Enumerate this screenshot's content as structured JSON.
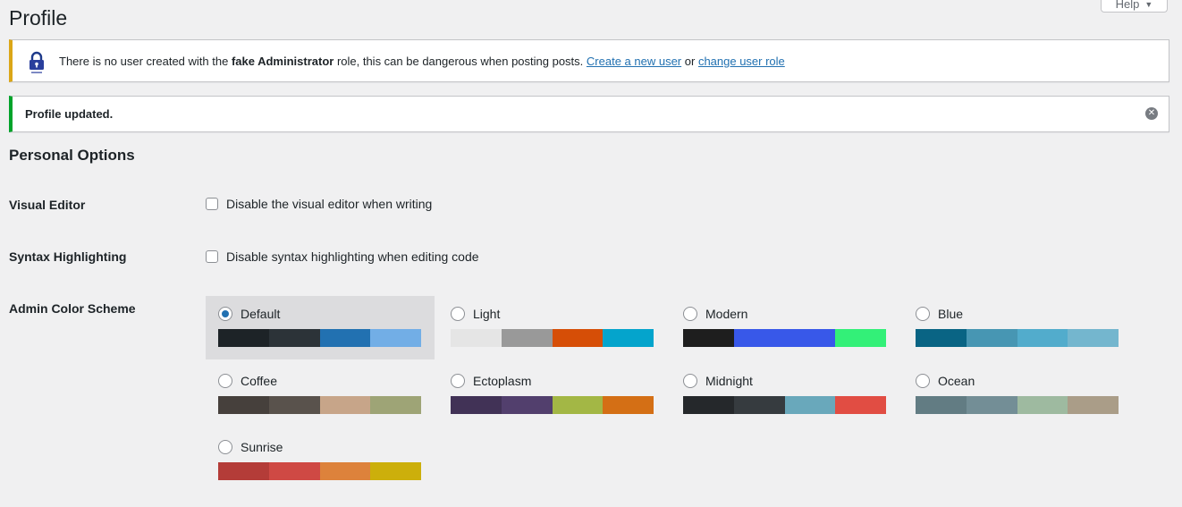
{
  "page": {
    "title": "Profile",
    "help_label": "Help"
  },
  "warning_notice": {
    "text_before": "There is no user created with the ",
    "role": "fake Administrator",
    "text_after": " role, this can be dangerous when posting posts. ",
    "link_create": "Create a new user",
    "connector": " or ",
    "link_change": "change user role"
  },
  "success_notice": {
    "text": "Profile updated."
  },
  "personal_options": {
    "title": "Personal Options",
    "visual_editor": {
      "label": "Visual Editor",
      "option": "Disable the visual editor when writing"
    },
    "syntax_highlighting": {
      "label": "Syntax Highlighting",
      "option": "Disable syntax highlighting when editing code"
    },
    "admin_color_scheme": {
      "label": "Admin Color Scheme",
      "selected": "Default",
      "schemes": [
        {
          "name": "Default",
          "colors": [
            "#1d2327",
            "#2c3338",
            "#2271b1",
            "#72aee6"
          ]
        },
        {
          "name": "Light",
          "colors": [
            "#e5e5e5",
            "#999999",
            "#d64e07",
            "#04a4cc"
          ]
        },
        {
          "name": "Modern",
          "colors": [
            "#1e1e1e",
            "#3858e9",
            "#3858e9",
            "#33f078"
          ]
        },
        {
          "name": "Blue",
          "colors": [
            "#096484",
            "#4796b3",
            "#52accc",
            "#74b6ce"
          ]
        },
        {
          "name": "Coffee",
          "colors": [
            "#46403c",
            "#59524c",
            "#c7a589",
            "#9ea476"
          ]
        },
        {
          "name": "Ectoplasm",
          "colors": [
            "#413256",
            "#523f6d",
            "#a3b745",
            "#d46f15"
          ]
        },
        {
          "name": "Midnight",
          "colors": [
            "#25282b",
            "#363b3f",
            "#69a8bb",
            "#e14d43"
          ]
        },
        {
          "name": "Ocean",
          "colors": [
            "#627c83",
            "#738e96",
            "#9ebaa0",
            "#aa9d88"
          ]
        },
        {
          "name": "Sunrise",
          "colors": [
            "#b43c38",
            "#cf4944",
            "#dd823b",
            "#ccaf0b"
          ]
        }
      ]
    }
  }
}
